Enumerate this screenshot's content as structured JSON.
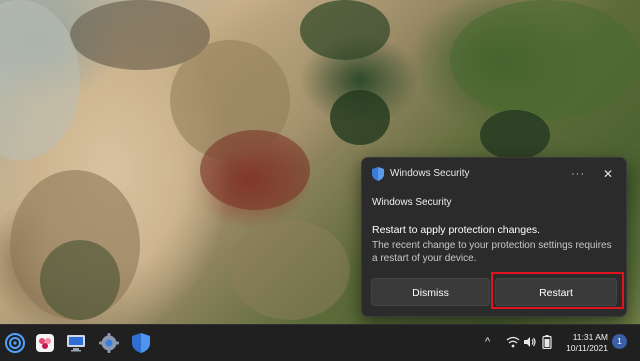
{
  "notification": {
    "app_name": "Windows Security",
    "more_label": "···",
    "close_label": "✕",
    "sender": "Windows Security",
    "title": "Restart to apply protection changes.",
    "body": "The recent change to your protection settings requires a restart of your device.",
    "dismiss_label": "Dismiss",
    "restart_label": "Restart"
  },
  "taskbar": {
    "apps": [
      {
        "name": "wifi-settings-icon"
      },
      {
        "name": "photos-icon"
      },
      {
        "name": "monitor-icon"
      },
      {
        "name": "settings-gear-icon"
      },
      {
        "name": "windows-security-icon"
      }
    ],
    "tray": {
      "chevron": "^",
      "time": "11:31 AM",
      "date": "10/11/2021",
      "notification_count": "1"
    }
  },
  "colors": {
    "toast_bg": "#2b2b2b",
    "taskbar_bg": "#202020",
    "highlight": "#e0141e",
    "accent": "#3a7bd5"
  }
}
